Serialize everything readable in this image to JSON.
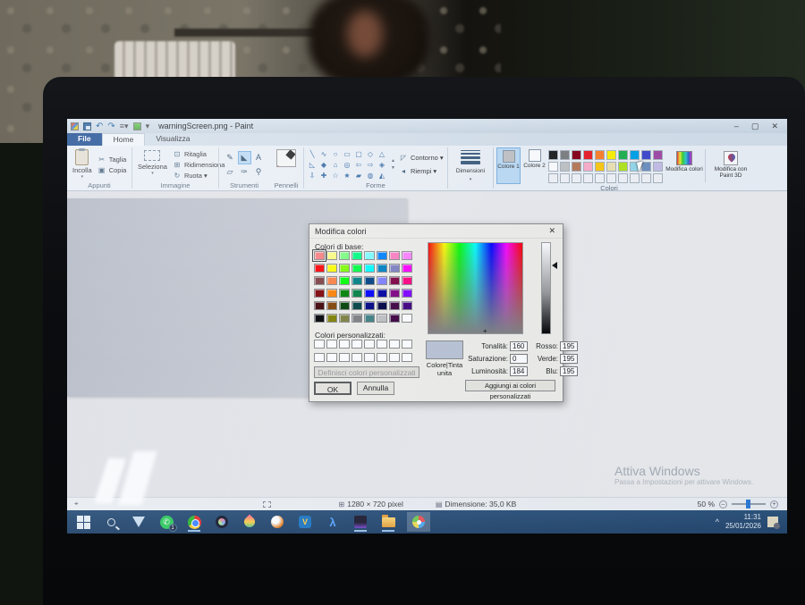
{
  "window": {
    "title": "warningScreen.png - Paint",
    "controls": {
      "minimize": "–",
      "maximize": "▢",
      "close": "✕"
    }
  },
  "tabs": {
    "file": "File",
    "home": "Home",
    "view": "Visualizza"
  },
  "ribbon": {
    "paste": "Incolla",
    "cut": "Taglia",
    "copy": "Copia",
    "clipboard_group": "Appunti",
    "select": "Seleziona",
    "crop": "Ritaglia",
    "resize": "Ridimensiona",
    "rotate": "Ruota ▾",
    "image_group": "Immagine",
    "tools_group": "Strumenti",
    "brushes": "Pennelli",
    "shapes_group": "Forme",
    "outline": "Contorno ▾",
    "fill": "Riempi ▾",
    "sizes": "Dimensioni",
    "color1": "Colore 1",
    "color2": "Colore 2",
    "colors_group": "Colori",
    "edit_colors": "Modifica colori",
    "paint3d": "Modifica con Paint 3D",
    "shape_glyphs": [
      "╲",
      "∿",
      "○",
      "▭",
      "▢",
      "◇",
      "△",
      "◺",
      "◆",
      "⌂",
      "◎",
      "⇦",
      "⇨",
      "◈",
      "⇩",
      "✚",
      "☆",
      "★",
      "▰",
      "◍",
      "◭"
    ],
    "palette_row1": [
      "#1e1e1e",
      "#7f7f7f",
      "#880015",
      "#ed1c24",
      "#ff7f27",
      "#fff200",
      "#22b14c",
      "#00a2e8",
      "#3f48cc",
      "#a349a4"
    ],
    "palette_row2": [
      "#ffffff",
      "#c3c3c3",
      "#b97a57",
      "#ffaec9",
      "#ffc90e",
      "#efe4b0",
      "#b5e61d",
      "#99d9ea",
      "#7092be",
      "#c8bfe7"
    ],
    "palette_row3": [
      "#f4f5f7",
      "#f4f5f7",
      "#f4f5f7",
      "#f4f5f7",
      "#f4f5f7",
      "#f4f5f7",
      "#f4f5f7",
      "#f4f5f7",
      "#f4f5f7",
      "#f4f5f7"
    ],
    "color1_value": "#c3c3c3",
    "color2_value": "#ffffff"
  },
  "dialog": {
    "title": "Modifica colori",
    "close": "✕",
    "basic_label": "Colori di base:",
    "custom_label": "Colori personalizzati:",
    "define_button": "Definisci colori personalizzati >>",
    "ok": "OK",
    "cancel": "Annulla",
    "add_button": "Aggiungi ai colori personalizzati",
    "color_label": "Colore|Tinta",
    "solid_label": "unita",
    "hue_label": "Tonalità:",
    "hue_value": "160",
    "sat_label": "Saturazione:",
    "sat_value": "0",
    "lum_label": "Luminosità:",
    "lum_value": "184",
    "red_label": "Rosso:",
    "red_value": "195",
    "green_label": "Verde:",
    "green_value": "195",
    "blue_label": "Blu:",
    "blue_value": "195",
    "preview_color": "#bcc4d4",
    "basic_colors": [
      "#ff8080",
      "#ffff80",
      "#80ff80",
      "#00ff80",
      "#80ffff",
      "#0080ff",
      "#ff80c0",
      "#ff80ff",
      "#ff0000",
      "#ffff00",
      "#80ff00",
      "#00ff40",
      "#00ffff",
      "#0080c0",
      "#8080c0",
      "#ff00ff",
      "#804040",
      "#ff8040",
      "#00ff00",
      "#008080",
      "#004080",
      "#8080ff",
      "#800040",
      "#ff0080",
      "#800000",
      "#ff8000",
      "#008000",
      "#008040",
      "#0000ff",
      "#0000a0",
      "#800080",
      "#8000ff",
      "#400000",
      "#804000",
      "#004000",
      "#004040",
      "#000080",
      "#000040",
      "#400040",
      "#400080",
      "#000000",
      "#808000",
      "#808040",
      "#808080",
      "#408080",
      "#c0c0c0",
      "#400040",
      "#ffffff"
    ],
    "custom_colors": [
      "#ffffff",
      "#ffffff",
      "#ffffff",
      "#ffffff",
      "#ffffff",
      "#ffffff",
      "#ffffff",
      "#ffffff",
      "#ffffff",
      "#ffffff",
      "#ffffff",
      "#ffffff",
      "#ffffff",
      "#ffffff",
      "#ffffff",
      "#ffffff"
    ]
  },
  "status": {
    "size_label": "1280 × 720 pixel",
    "file_label": "Dimensione: 35,0 KB",
    "zoom_label": "50 %",
    "zoom_minus": "–",
    "zoom_plus": "+"
  },
  "taskbar": {
    "whatsapp_badge": "1",
    "tray_chevron": "^",
    "time": "11:31",
    "date": "25/01/2026"
  },
  "watermark": {
    "line1": "Attiva Windows",
    "line2": "Passa a Impostazioni per attivare Windows."
  }
}
